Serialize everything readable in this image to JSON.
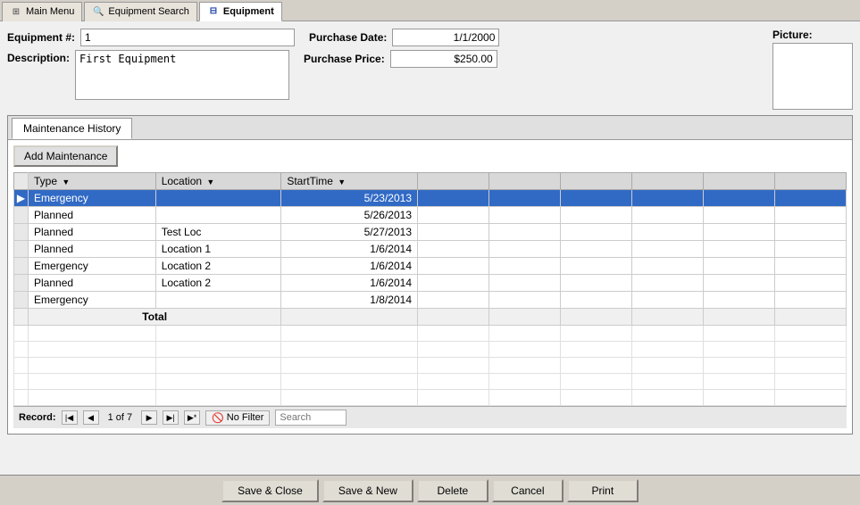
{
  "tabs": [
    {
      "id": "main-menu",
      "label": "Main Menu",
      "icon": "⊞",
      "active": false
    },
    {
      "id": "equipment-search",
      "label": "Equipment Search",
      "icon": "🔍",
      "active": false
    },
    {
      "id": "equipment",
      "label": "Equipment",
      "icon": "⊟",
      "active": true
    }
  ],
  "form": {
    "equipment_num_label": "Equipment #:",
    "equipment_num_value": "1",
    "description_label": "Description:",
    "description_value": "First Equipment",
    "purchase_date_label": "Purchase Date:",
    "purchase_date_value": "1/1/2000",
    "purchase_price_label": "Purchase Price:",
    "purchase_price_value": "$250.00",
    "picture_label": "Picture:"
  },
  "maintenance": {
    "tab_label": "Maintenance History",
    "add_button": "Add Maintenance",
    "columns": [
      {
        "id": "type",
        "label": "Type",
        "sortable": true
      },
      {
        "id": "location",
        "label": "Location",
        "sortable": true
      },
      {
        "id": "starttime",
        "label": "StartTime",
        "sortable": true
      }
    ],
    "rows": [
      {
        "selected": true,
        "type": "Emergency",
        "location": "",
        "starttime": "5/23/2013"
      },
      {
        "selected": false,
        "type": "Planned",
        "location": "",
        "starttime": "5/26/2013"
      },
      {
        "selected": false,
        "type": "Planned",
        "location": "Test Loc",
        "starttime": "5/27/2013"
      },
      {
        "selected": false,
        "type": "Planned",
        "location": "Location 1",
        "starttime": "1/6/2014"
      },
      {
        "selected": false,
        "type": "Emergency",
        "location": "Location 2",
        "starttime": "1/6/2014"
      },
      {
        "selected": false,
        "type": "Planned",
        "location": "Location 2",
        "starttime": "1/6/2014"
      },
      {
        "selected": false,
        "type": "Emergency",
        "location": "",
        "starttime": "1/8/2014"
      }
    ],
    "total_label": "Total",
    "empty_rows": 5
  },
  "statusbar": {
    "record_label": "Record:",
    "record_info": "1 of 7",
    "no_filter": "No Filter",
    "search_placeholder": "Search"
  },
  "buttons": {
    "save_close": "Save & Close",
    "save_new": "Save & New",
    "delete": "Delete",
    "cancel": "Cancel",
    "print": "Print"
  }
}
